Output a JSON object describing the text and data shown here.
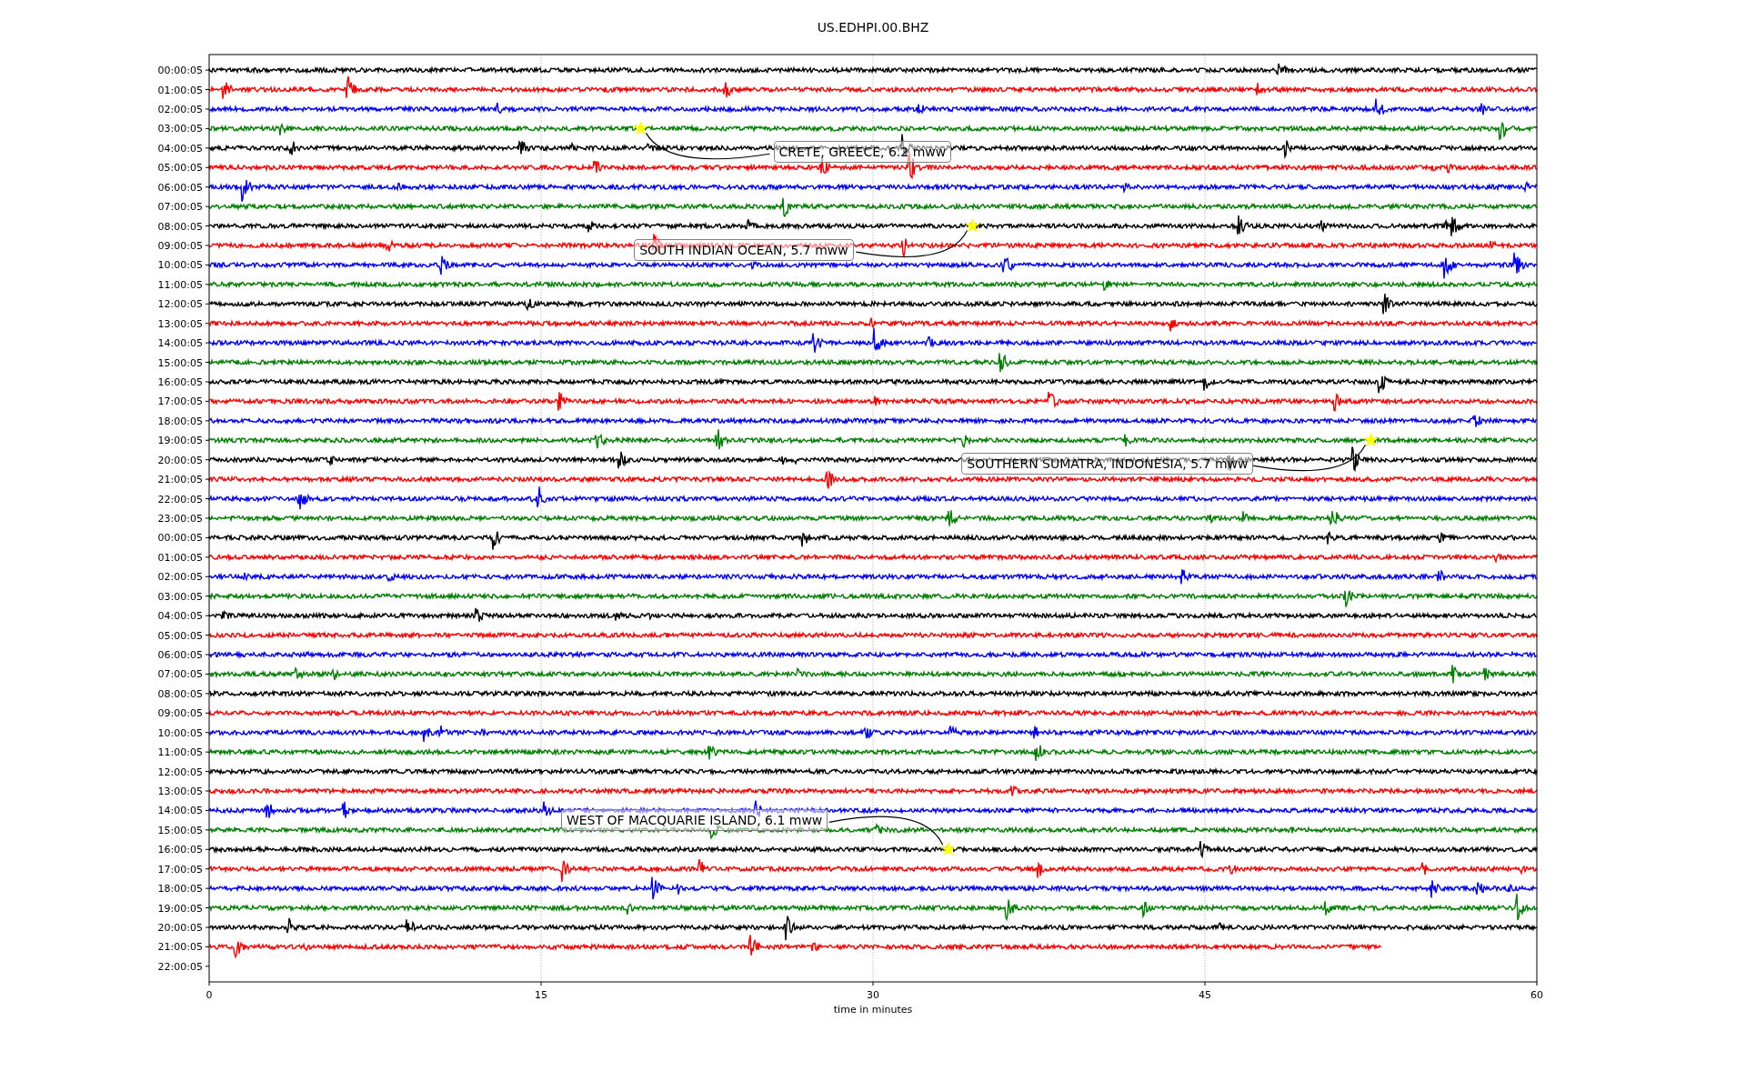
{
  "plot": {
    "title": "US.EDHPI.00.BHZ",
    "xlabel": "time in minutes",
    "xtick_labels": [
      "0",
      "15",
      "30",
      "45",
      "60"
    ],
    "rows": [
      {
        "label": "00:00:05",
        "color": "#000000"
      },
      {
        "label": "01:00:05",
        "color": "#ff0000"
      },
      {
        "label": "02:00:05",
        "color": "#0000ff"
      },
      {
        "label": "03:00:05",
        "color": "#008000"
      },
      {
        "label": "04:00:05",
        "color": "#000000"
      },
      {
        "label": "05:00:05",
        "color": "#ff0000"
      },
      {
        "label": "06:00:05",
        "color": "#0000ff"
      },
      {
        "label": "07:00:05",
        "color": "#008000"
      },
      {
        "label": "08:00:05",
        "color": "#000000"
      },
      {
        "label": "09:00:05",
        "color": "#ff0000"
      },
      {
        "label": "10:00:05",
        "color": "#0000ff"
      },
      {
        "label": "11:00:05",
        "color": "#008000"
      },
      {
        "label": "12:00:05",
        "color": "#000000"
      },
      {
        "label": "13:00:05",
        "color": "#ff0000"
      },
      {
        "label": "14:00:05",
        "color": "#0000ff"
      },
      {
        "label": "15:00:05",
        "color": "#008000"
      },
      {
        "label": "16:00:05",
        "color": "#000000"
      },
      {
        "label": "17:00:05",
        "color": "#ff0000"
      },
      {
        "label": "18:00:05",
        "color": "#0000ff"
      },
      {
        "label": "19:00:05",
        "color": "#008000"
      },
      {
        "label": "20:00:05",
        "color": "#000000"
      },
      {
        "label": "21:00:05",
        "color": "#ff0000"
      },
      {
        "label": "22:00:05",
        "color": "#0000ff"
      },
      {
        "label": "23:00:05",
        "color": "#008000"
      },
      {
        "label": "00:00:05",
        "color": "#000000"
      },
      {
        "label": "01:00:05",
        "color": "#ff0000"
      },
      {
        "label": "02:00:05",
        "color": "#0000ff"
      },
      {
        "label": "03:00:05",
        "color": "#008000"
      },
      {
        "label": "04:00:05",
        "color": "#000000"
      },
      {
        "label": "05:00:05",
        "color": "#ff0000"
      },
      {
        "label": "06:00:05",
        "color": "#0000ff"
      },
      {
        "label": "07:00:05",
        "color": "#008000"
      },
      {
        "label": "08:00:05",
        "color": "#000000"
      },
      {
        "label": "09:00:05",
        "color": "#ff0000"
      },
      {
        "label": "10:00:05",
        "color": "#0000ff"
      },
      {
        "label": "11:00:05",
        "color": "#008000"
      },
      {
        "label": "12:00:05",
        "color": "#000000"
      },
      {
        "label": "13:00:05",
        "color": "#ff0000"
      },
      {
        "label": "14:00:05",
        "color": "#0000ff"
      },
      {
        "label": "15:00:05",
        "color": "#008000"
      },
      {
        "label": "16:00:05",
        "color": "#000000"
      },
      {
        "label": "17:00:05",
        "color": "#ff0000"
      },
      {
        "label": "18:00:05",
        "color": "#0000ff"
      },
      {
        "label": "19:00:05",
        "color": "#008000"
      },
      {
        "label": "20:00:05",
        "color": "#000000"
      },
      {
        "label": "21:00:05",
        "color": "#ff0000"
      },
      {
        "label": "22:00:05"
      }
    ],
    "events": [
      "CRETE, GREECE, 6.2 mww",
      "SOUTH INDIAN OCEAN, 5.7 mww",
      "SOUTHERN SUMATRA, INDONESIA, 5.7 mww",
      "WEST OF MACQUARIE ISLAND, 6.1 mww"
    ]
  }
}
